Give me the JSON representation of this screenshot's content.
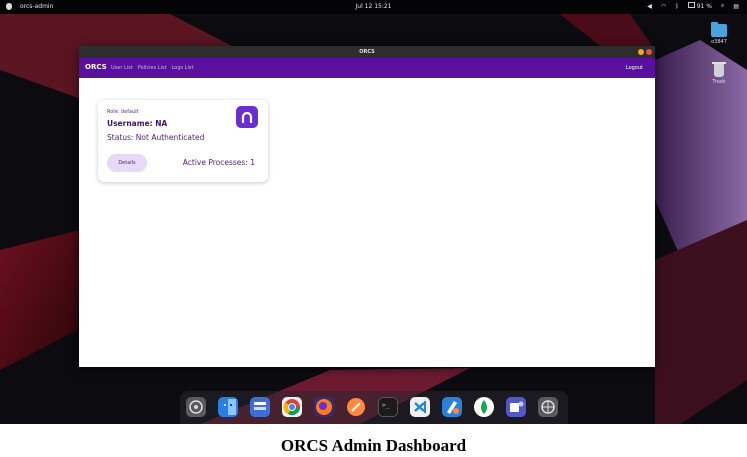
{
  "topbar": {
    "app_name": "orcs-admin",
    "clock": "Jul 12  15:21",
    "battery": "91 %"
  },
  "desktop_icons": [
    {
      "label": "o3847",
      "icon": "folder-icon"
    },
    {
      "label": "Trash",
      "icon": "trash-icon"
    }
  ],
  "window": {
    "title": "ORCS",
    "nav": {
      "brand": "ORCS",
      "links": [
        "User List",
        "Policies List",
        "Logs List"
      ],
      "logout": "Logout"
    },
    "card": {
      "role": "Role: default",
      "username": "Username: NA",
      "status": "Status: Not Authenticated",
      "details_button": "Details",
      "active_processes": "Active Processes: 1"
    }
  },
  "dock": [
    "settings",
    "finder",
    "files",
    "chrome",
    "firefox",
    "safari",
    "terminal",
    "vscode",
    "xcode",
    "mongodb",
    "teams",
    "system-preferences"
  ],
  "caption": "ORCS Admin Dashboard",
  "colors": {
    "nav_purple": "#5b0f9e",
    "card_text": "#4a1f7a",
    "button_bg": "#e8d9f7"
  }
}
